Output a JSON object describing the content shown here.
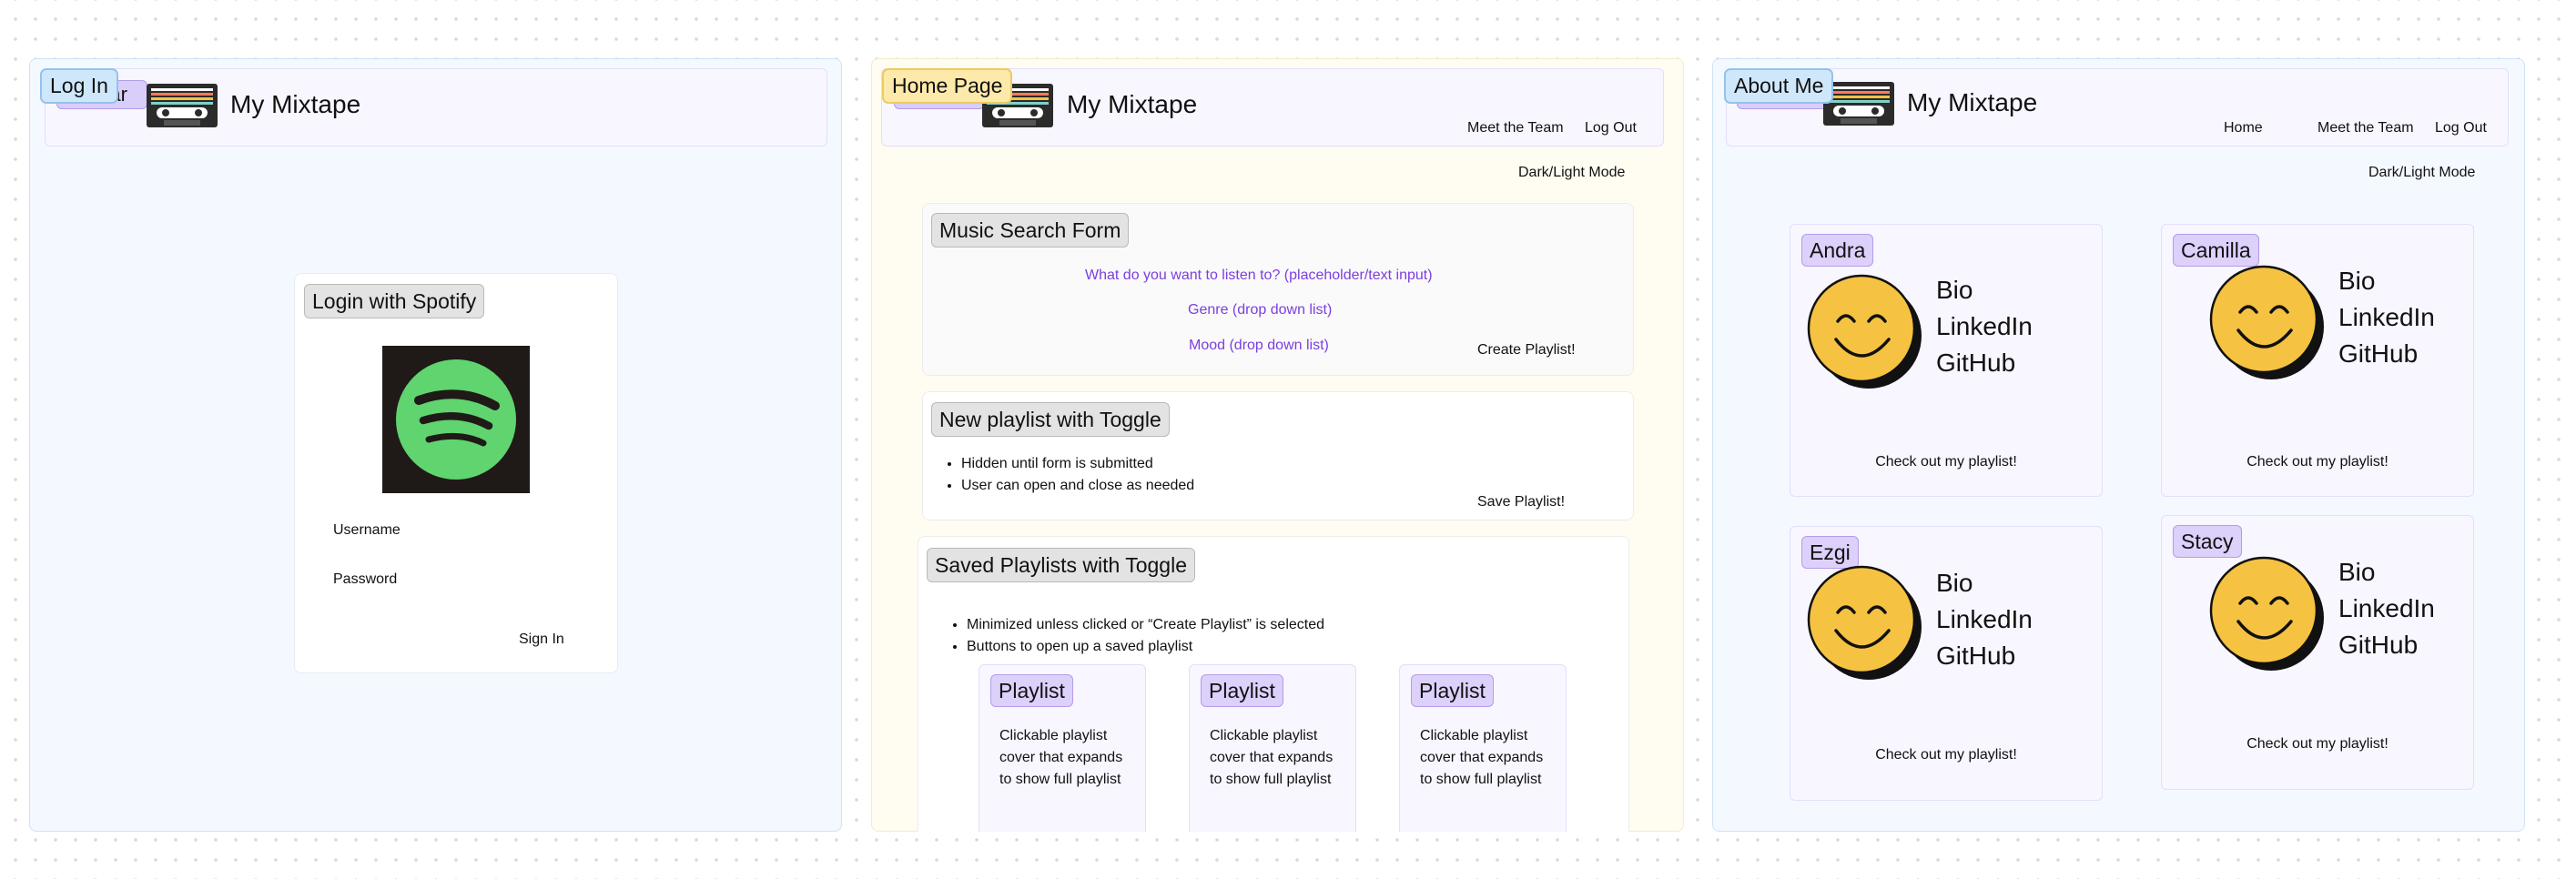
{
  "app_title": "My Mixtape",
  "login": {
    "frame_label": "Log In",
    "navbar_tag": "Navbar",
    "card_heading": "Login with Spotify",
    "username_label": "Username",
    "password_label": "Password",
    "sign_in": "Sign In"
  },
  "home": {
    "frame_label": "Home Page",
    "navbar_tag": "Navbar",
    "nav_links": [
      "Meet the Team",
      "Log Out"
    ],
    "mode_toggle": "Dark/Light Mode",
    "search_form": {
      "heading": "Music Search Form",
      "query_placeholder": "What do you want to listen to? (placeholder/text input)",
      "genre": "Genre (drop down list)",
      "mood": "Mood (drop down list)",
      "create_button": "Create Playlist!"
    },
    "new_playlist": {
      "heading": "New playlist with Toggle",
      "bullets": [
        "Hidden until form is submitted",
        "User can open and close as needed"
      ],
      "save_button": "Save Playlist!"
    },
    "saved_playlists": {
      "heading": "Saved Playlists with Toggle",
      "bullets": [
        "Minimized unless clicked or “Create Playlist” is selected",
        "Buttons to open up a saved playlist"
      ],
      "cards": [
        {
          "title": "Playlist",
          "desc": "Clickable playlist cover that expands to show full playlist"
        },
        {
          "title": "Playlist",
          "desc": "Clickable playlist cover that expands to show full playlist"
        },
        {
          "title": "Playlist",
          "desc": "Clickable playlist cover that expands to show full playlist"
        }
      ]
    }
  },
  "about": {
    "frame_label": "About Me",
    "navbar_tag": "Navbar",
    "nav_links": [
      "Home",
      "Meet the Team",
      "Log Out"
    ],
    "mode_toggle": "Dark/Light Mode",
    "members": [
      {
        "name": "Andra",
        "links": [
          "Bio",
          "LinkedIn",
          "GitHub"
        ],
        "cta": "Check out my playlist!"
      },
      {
        "name": "Camilla",
        "links": [
          "Bio",
          "LinkedIn",
          "GitHub"
        ],
        "cta": "Check out my playlist!"
      },
      {
        "name": "Ezgi",
        "links": [
          "Bio",
          "LinkedIn",
          "GitHub"
        ],
        "cta": "Check out my playlist!"
      },
      {
        "name": "Stacy",
        "links": [
          "Bio",
          "LinkedIn",
          "GitHub"
        ],
        "cta": "Check out my playlist!"
      }
    ]
  },
  "colors": {
    "frame_blue": "#f4f9ff",
    "frame_yellow": "#fffcf1",
    "navbar_lavender": "#f8f6ff",
    "accent_purple": "#7c3fe0",
    "spotify_green": "#1ed760",
    "smiley_yellow": "#f5c242"
  }
}
